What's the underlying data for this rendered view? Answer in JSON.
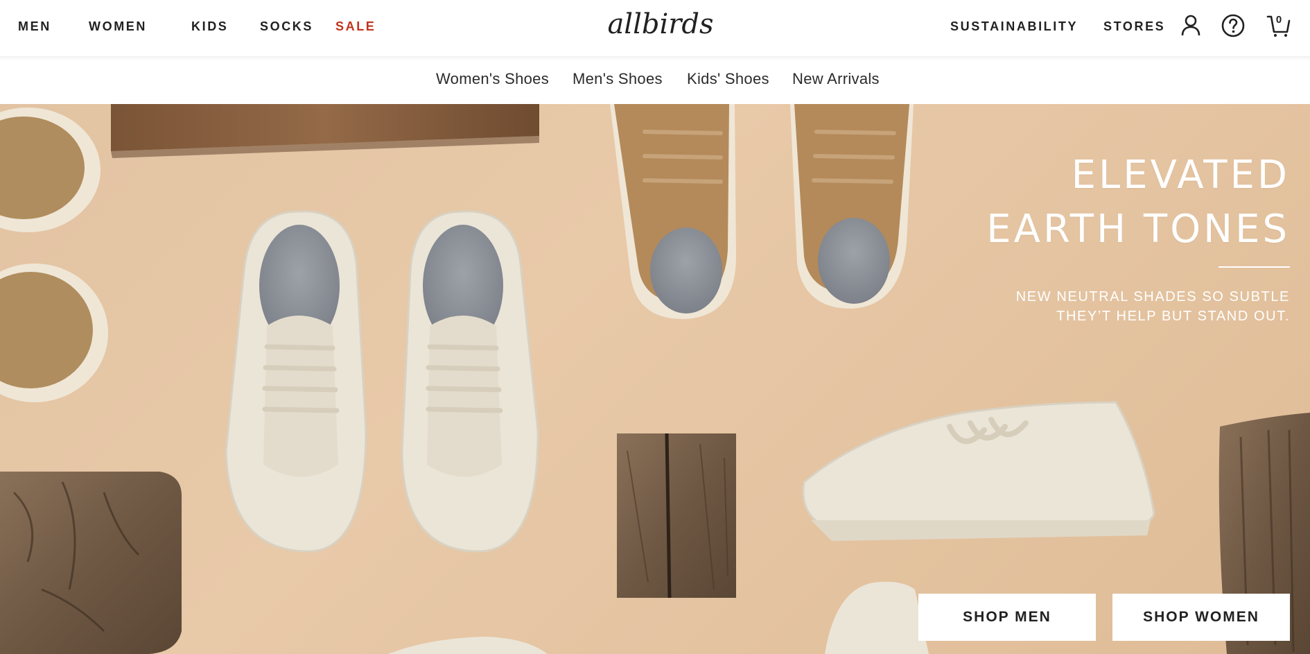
{
  "nav": {
    "left": [
      {
        "label": "MEN"
      },
      {
        "label": "WOMEN"
      },
      {
        "label": "KIDS"
      },
      {
        "label": "SOCKS"
      },
      {
        "label": "SALE"
      }
    ],
    "logo_text": "allbirds",
    "right": [
      {
        "label": "SUSTAINABILITY"
      },
      {
        "label": "STORES"
      }
    ],
    "cart_count": "0",
    "icons": [
      "account-icon",
      "help-icon",
      "cart-icon"
    ]
  },
  "subnav": [
    {
      "label": "Women's Shoes"
    },
    {
      "label": "Men's Shoes"
    },
    {
      "label": "Kids' Shoes"
    },
    {
      "label": "New Arrivals"
    }
  ],
  "hero": {
    "headline_line1": "ELEVATED",
    "headline_line2": "EARTH TONES",
    "subline_line1": "NEW NEUTRAL SHADES SO SUBTLE",
    "subline_line2": "THEY’T HELP BUT STAND OUT.",
    "cta_men": "SHOP MEN",
    "cta_women": "SHOP WOMEN"
  },
  "colors": {
    "sale": "#c0341d",
    "hero_bg": "#e2c3a2",
    "text": "#212121"
  }
}
